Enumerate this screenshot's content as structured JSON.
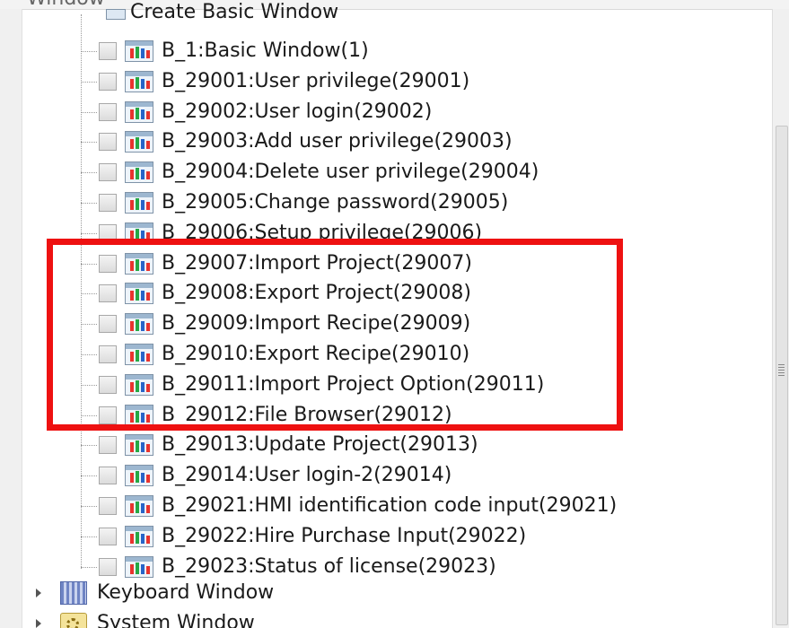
{
  "header": {
    "title": "Window"
  },
  "tree": {
    "parent_label": "Create Basic Window",
    "items": [
      {
        "label": "B_1:Basic Window(1)",
        "checked": false
      },
      {
        "label": "B_29001:User privilege(29001)",
        "checked": false
      },
      {
        "label": "B_29002:User login(29002)",
        "checked": false
      },
      {
        "label": "B_29003:Add user privilege(29003)",
        "checked": false
      },
      {
        "label": "B_29004:Delete user privilege(29004)",
        "checked": false
      },
      {
        "label": "B_29005:Change password(29005)",
        "checked": false
      },
      {
        "label": "B_29006:Setup privilege(29006)",
        "checked": false
      },
      {
        "label": "B_29007:Import Project(29007)",
        "checked": false
      },
      {
        "label": "B_29008:Export Project(29008)",
        "checked": false
      },
      {
        "label": "B_29009:Import Recipe(29009)",
        "checked": false
      },
      {
        "label": "B_29010:Export Recipe(29010)",
        "checked": false
      },
      {
        "label": "B_29011:Import Project Option(29011)",
        "checked": false
      },
      {
        "label": "B_29012:File Browser(29012)",
        "checked": false
      },
      {
        "label": "B_29013:Update Project(29013)",
        "checked": false
      },
      {
        "label": "B_29014:User login-2(29014)",
        "checked": false
      },
      {
        "label": "B_29021:HMI identification code input(29021)",
        "checked": false
      },
      {
        "label": "B_29022:Hire Purchase Input(29022)",
        "checked": false
      },
      {
        "label": "B_29023:Status of license(29023)",
        "checked": false
      }
    ],
    "folders": [
      {
        "label": "Keyboard Window",
        "icon": "keyboard-icon"
      },
      {
        "label": "System Window",
        "icon": "gear-icon"
      }
    ]
  },
  "colors": {
    "highlight": "#ee1111",
    "icon_red": "#e8332e",
    "icon_green": "#27a844",
    "icon_blue": "#2764c8"
  }
}
